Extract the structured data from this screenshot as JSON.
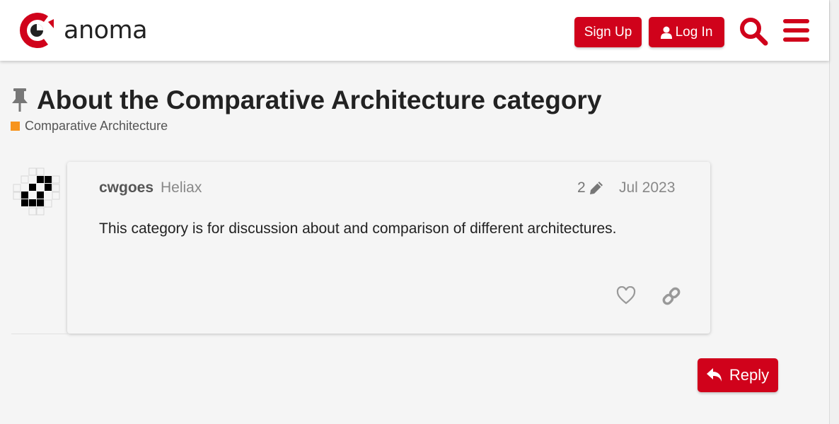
{
  "header": {
    "logo_text": "anoma",
    "signup_label": "Sign Up",
    "login_label": "Log In",
    "search_icon": "search-icon",
    "menu_icon": "hamburger-menu-icon"
  },
  "topic": {
    "title": "About the Comparative Architecture category",
    "pinned_icon": "pin-icon",
    "category": {
      "label": "Comparative Architecture",
      "color": "#f7941d"
    }
  },
  "post": {
    "author": "cwgoes",
    "org": "Heliax",
    "edit_count": "2",
    "date": "Jul 2023",
    "body": "This category is for discussion about and comparison of different architectures.",
    "like_icon": "heart-icon",
    "share_icon": "link-icon"
  },
  "actions": {
    "reply_label": "Reply"
  },
  "colors": {
    "accent": "#d0021b",
    "background": "#f5f5f5"
  }
}
